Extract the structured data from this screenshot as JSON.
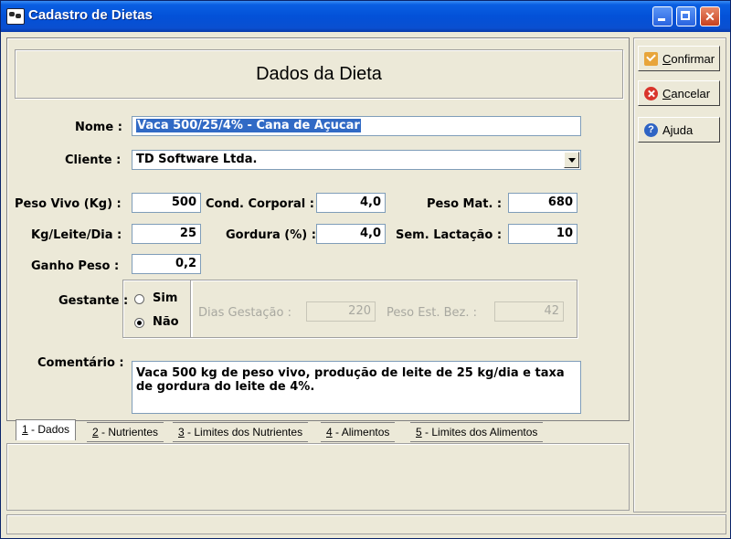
{
  "window": {
    "title": "Cadastro de Dietas"
  },
  "header": {
    "title": "Dados da Dieta"
  },
  "form": {
    "nome_label": "Nome :",
    "nome_value": "Vaca 500/25/4% - Cana de Açucar",
    "cliente_label": "Cliente :",
    "cliente_value": "TD Software Ltda.",
    "peso_vivo_label": "Peso Vivo (Kg) :",
    "peso_vivo_value": "500",
    "cond_corporal_label": "Cond. Corporal :",
    "cond_corporal_value": "4,0",
    "peso_mat_label": "Peso Mat. :",
    "peso_mat_value": "680",
    "kg_leite_label": "Kg/Leite/Dia :",
    "kg_leite_value": "25",
    "gordura_label": "Gordura (%) :",
    "gordura_value": "4,0",
    "sem_lactacao_label": "Sem. Lactação :",
    "sem_lactacao_value": "10",
    "ganho_peso_label": "Ganho Peso :",
    "ganho_peso_value": "0,2",
    "gestante_label": "Gestante :",
    "gestante_options": [
      "Sim",
      "Não"
    ],
    "gestante_selected": "Não",
    "dias_gestacao_label": "Dias Gestação :",
    "dias_gestacao_value": "220",
    "peso_est_bez_label": "Peso Est. Bez. :",
    "peso_est_bez_value": "42",
    "comentario_label": "Comentário :",
    "comentario_value": "Vaca 500 kg de peso vivo, produção de leite de 25 kg/dia e taxa de gordura do leite de 4%."
  },
  "tabs": [
    {
      "key": "1",
      "label": " - Dados",
      "active": true
    },
    {
      "key": "2",
      "label": " - Nutrientes",
      "active": false
    },
    {
      "key": "3",
      "label": " - Limites dos Nutrientes",
      "active": false
    },
    {
      "key": "4",
      "label": " - Alimentos",
      "active": false
    },
    {
      "key": "5",
      "label": " - Limites dos Alimentos",
      "active": false
    }
  ],
  "actions": {
    "confirm_hotkey": "C",
    "confirm_rest": "onfirmar",
    "cancel_hotkey": "C",
    "cancel_rest": "ancelar",
    "help_label": "Ajuda"
  },
  "icons": {
    "app": "cow-icon",
    "confirm": "check-icon",
    "cancel": "close-circle-icon",
    "help": "help-icon"
  },
  "colors": {
    "titlebar": "#0a5fe2",
    "selection": "#316ac5",
    "face": "#ece9d8"
  }
}
